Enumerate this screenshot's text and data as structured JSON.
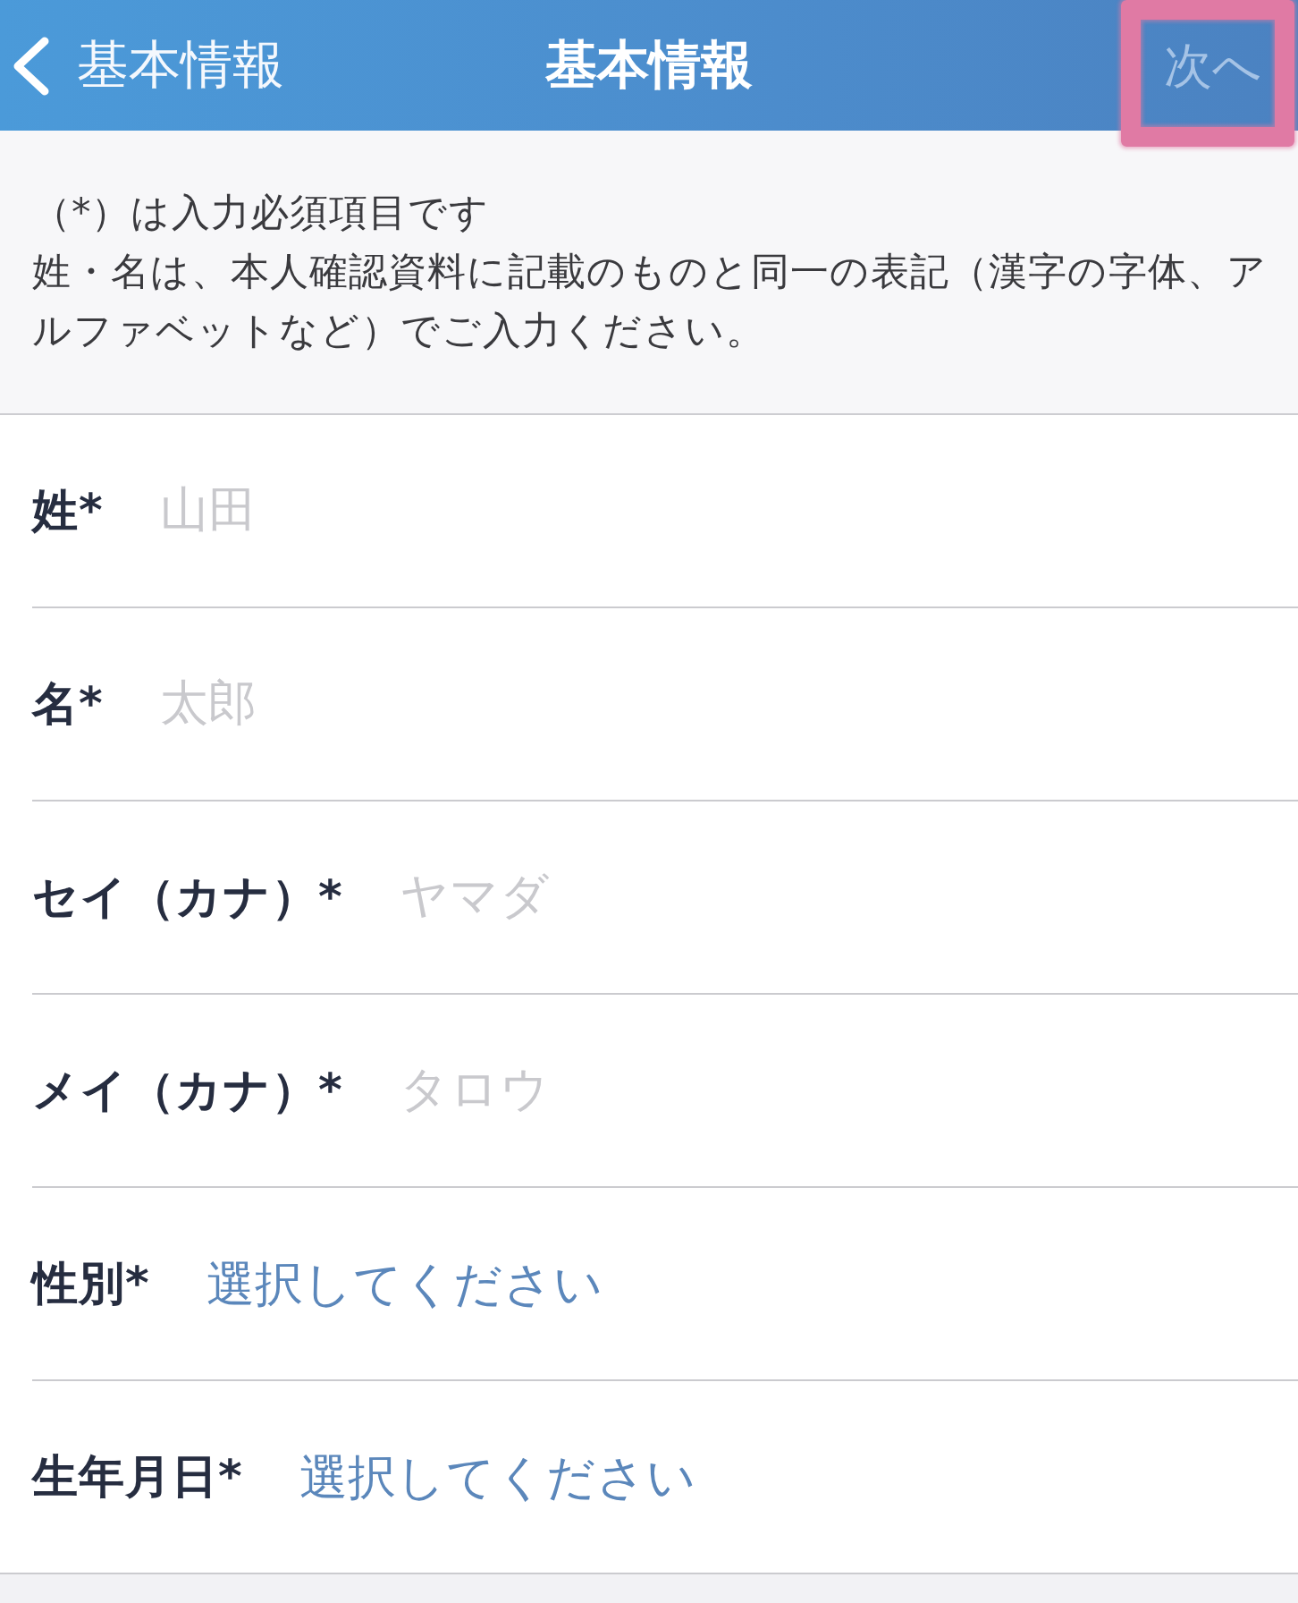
{
  "header": {
    "back_label": "基本情報",
    "title": "基本情報",
    "next_button": {
      "label": "次へ",
      "disabled": true,
      "highlighted": true
    }
  },
  "notice": {
    "lines": [
      "（*）は入力必須項目です",
      "姓・名は、本人確認資料に記載のものと同一の表記（漢字の字体、アルファベットなど）でご入力ください。"
    ]
  },
  "fields": [
    {
      "kind": "text",
      "label": "姓*",
      "placeholder": "山田"
    },
    {
      "kind": "text",
      "label": "名*",
      "placeholder": "太郎"
    },
    {
      "kind": "text",
      "label": "セイ（カナ）*",
      "placeholder": "ヤマダ"
    },
    {
      "kind": "text",
      "label": "メイ（カナ）*",
      "placeholder": "タロウ"
    },
    {
      "kind": "select",
      "label": "性別*",
      "placeholder": "選択してください"
    },
    {
      "kind": "select",
      "label": "生年月日*",
      "placeholder": "選択してください"
    }
  ]
}
